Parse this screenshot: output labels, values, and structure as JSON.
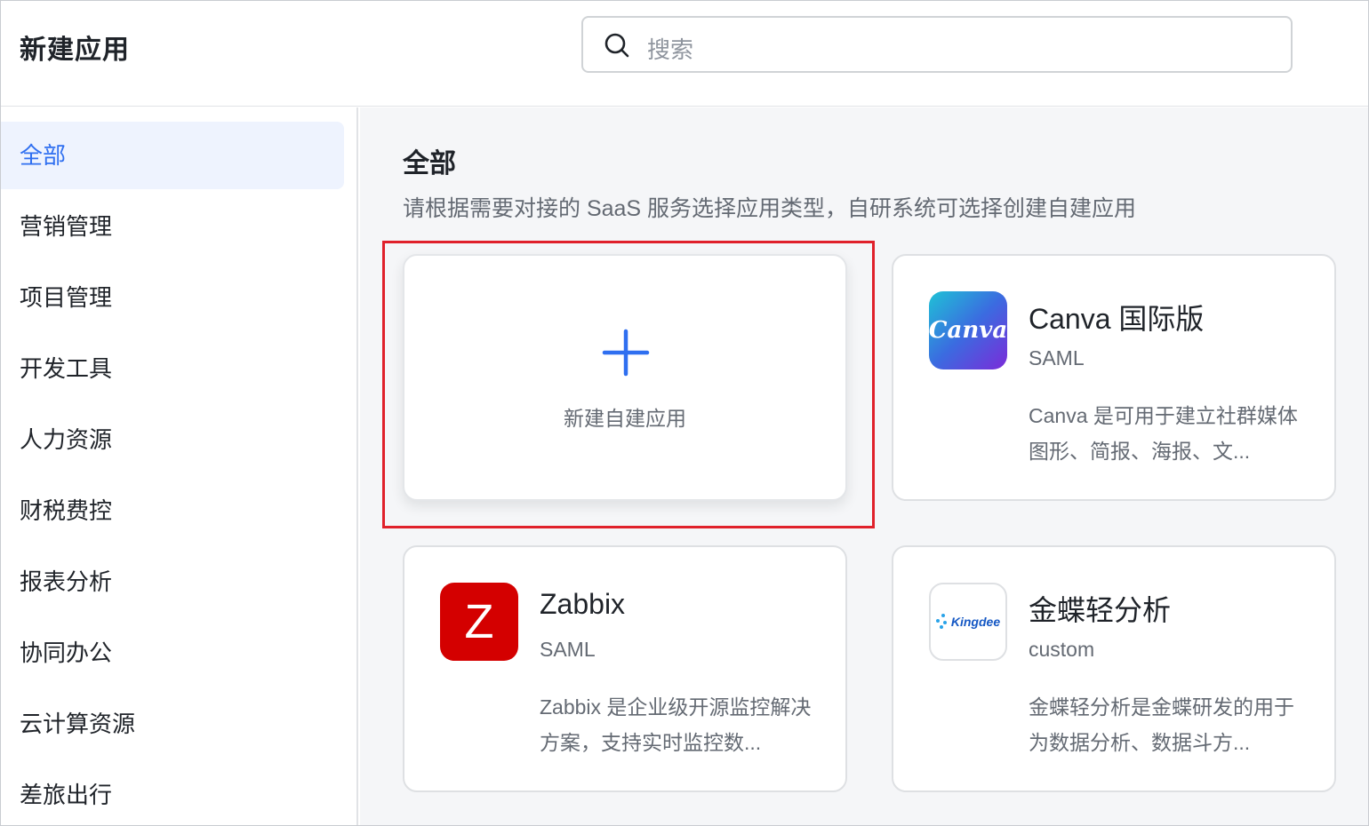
{
  "header": {
    "title": "新建应用",
    "search_placeholder": "搜索"
  },
  "sidebar": {
    "items": [
      {
        "label": "全部",
        "active": true
      },
      {
        "label": "营销管理"
      },
      {
        "label": "项目管理"
      },
      {
        "label": "开发工具"
      },
      {
        "label": "人力资源"
      },
      {
        "label": "财税费控"
      },
      {
        "label": "报表分析"
      },
      {
        "label": "协同办公"
      },
      {
        "label": "云计算资源"
      },
      {
        "label": "差旅出行"
      }
    ]
  },
  "main": {
    "title": "全部",
    "description": "请根据需要对接的 SaaS 服务选择应用类型，自研系统可选择创建自建应用",
    "new_app_label": "新建自建应用",
    "apps": [
      {
        "name": "Canva 国际版",
        "protocol": "SAML",
        "description": "Canva 是可用于建立社群媒体图形、简报、海报、文...",
        "logo_text": "Canva",
        "logo": "canva-logo"
      },
      {
        "name": "Zabbix",
        "protocol": "SAML",
        "description": "Zabbix 是企业级开源监控解决方案，支持实时监控数...",
        "logo_text": "Z",
        "logo": "zabbix-logo"
      },
      {
        "name": "金蝶轻分析",
        "protocol": "custom",
        "description": "金蝶轻分析是金蝶研发的用于为数据分析、数据斗方...",
        "logo_text": "Kingdee",
        "logo": "kingdee-logo"
      }
    ]
  },
  "colors": {
    "accent": "#2f6ff0",
    "active_bg": "#eef3fe",
    "highlight": "#e0212b",
    "zabbix_red": "#d40000"
  }
}
